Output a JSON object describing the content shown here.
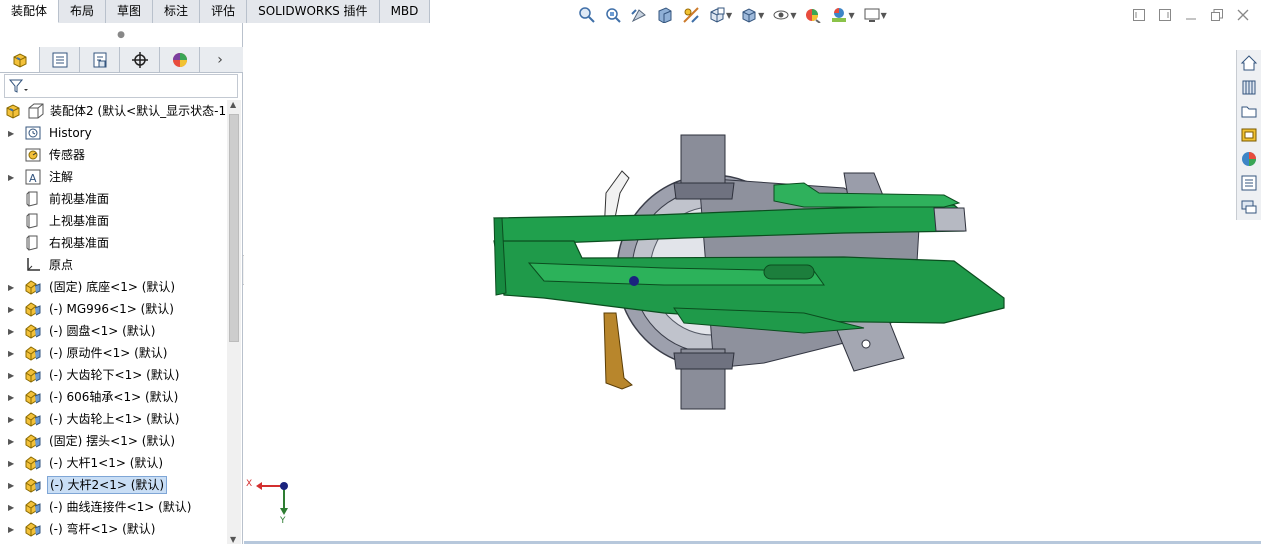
{
  "command_tabs": [
    {
      "label": "装配体",
      "active": true
    },
    {
      "label": "布局",
      "active": false
    },
    {
      "label": "草图",
      "active": false
    },
    {
      "label": "标注",
      "active": false
    },
    {
      "label": "评估",
      "active": false
    },
    {
      "label": "SOLIDWORKS 插件",
      "active": false
    },
    {
      "label": "MBD",
      "active": false
    }
  ],
  "hud_icons": [
    "zoom-to-fit-icon",
    "zoom-to-area-icon",
    "previous-view-icon",
    "section-view-icon",
    "dynamic-annotation-icon",
    "view-orientation-icon",
    "display-style-icon",
    "hide-show-items-icon",
    "edit-appearance-icon",
    "apply-scene-icon",
    "view-settings-icon"
  ],
  "manager_tabs": [
    "featuremanager-icon",
    "propertymanager-icon",
    "configurationmanager-icon",
    "dimxpert-icon",
    "displaymanager-icon"
  ],
  "tree": {
    "root_label": "装配体2  (默认<默认_显示状态-1",
    "items": [
      {
        "label": "History",
        "icon": "history-icon",
        "expandable": true
      },
      {
        "label": "传感器",
        "icon": "sensor-icon",
        "expandable": false
      },
      {
        "label": "注解",
        "icon": "annotation-icon",
        "expandable": true
      },
      {
        "label": "前视基准面",
        "icon": "plane-icon",
        "expandable": false
      },
      {
        "label": "上视基准面",
        "icon": "plane-icon",
        "expandable": false
      },
      {
        "label": "右视基准面",
        "icon": "plane-icon",
        "expandable": false
      },
      {
        "label": "原点",
        "icon": "origin-icon",
        "expandable": false
      },
      {
        "label": "(固定) 底座<1> (默认)",
        "icon": "part-icon",
        "expandable": true
      },
      {
        "label": "(-) MG996<1> (默认)",
        "icon": "part-icon",
        "expandable": true
      },
      {
        "label": "(-) 圆盘<1> (默认)",
        "icon": "part-icon",
        "expandable": true
      },
      {
        "label": "(-) 原动件<1> (默认)",
        "icon": "part-icon",
        "expandable": true
      },
      {
        "label": "(-) 大齿轮下<1> (默认)",
        "icon": "part-icon",
        "expandable": true
      },
      {
        "label": "(-) 606轴承<1> (默认)",
        "icon": "part-icon",
        "expandable": true
      },
      {
        "label": "(-) 大齿轮上<1> (默认)",
        "icon": "part-icon",
        "expandable": true
      },
      {
        "label": "(固定) 摆头<1> (默认)",
        "icon": "part-icon",
        "expandable": true
      },
      {
        "label": "(-) 大杆1<1> (默认)",
        "icon": "part-icon",
        "expandable": true
      },
      {
        "label": "(-) 大杆2<1> (默认)",
        "icon": "part-icon",
        "expandable": true,
        "selected": true
      },
      {
        "label": "(-) 曲线连接件<1> (默认)",
        "icon": "part-icon",
        "expandable": true
      },
      {
        "label": "(-) 弯杆<1> (默认)",
        "icon": "part-icon",
        "expandable": true
      }
    ]
  },
  "triad": {
    "x_label": "X",
    "y_label": "Y"
  },
  "task_pane_icons": [
    "solidworks-resources-icon",
    "design-library-icon",
    "file-explorer-icon",
    "view-palette-icon",
    "appearances-scenes-icon",
    "custom-properties-icon",
    "forum-icon"
  ],
  "colors": {
    "green_part": "#1f9a4a",
    "gray_part": "#8a8d9a",
    "selection": "#c9def5"
  }
}
